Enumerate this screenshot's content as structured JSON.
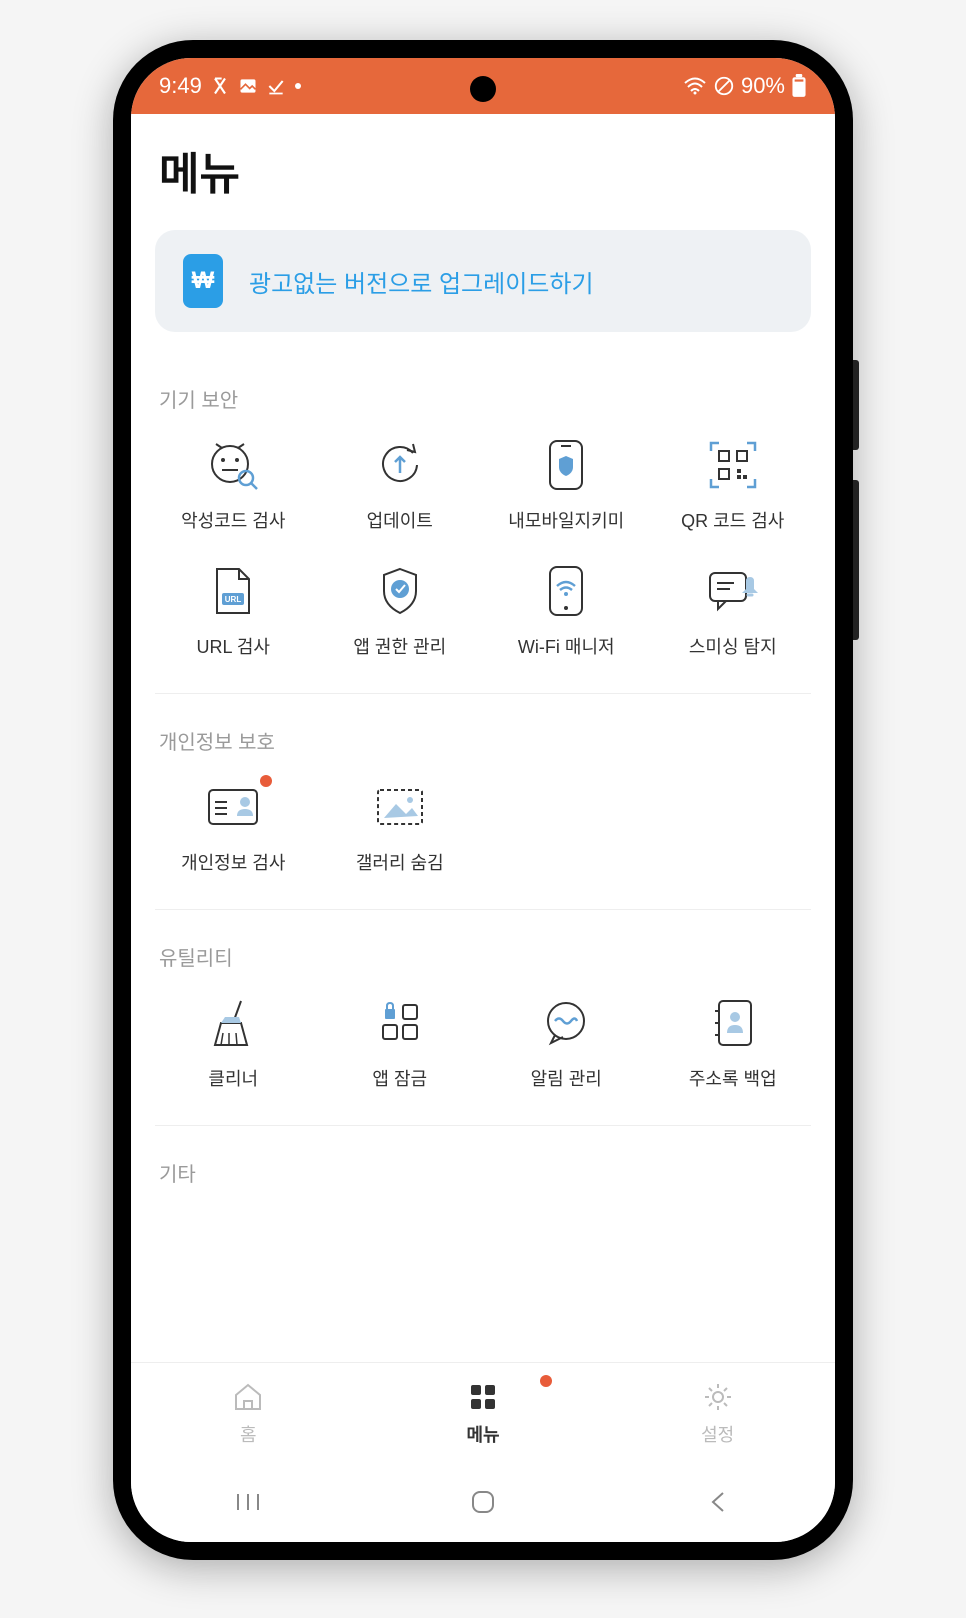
{
  "status": {
    "time": "9:49",
    "battery_label": "90%"
  },
  "title": "메뉴",
  "upgrade": {
    "icon_text": "₩",
    "text": "광고없는 버전으로 업그레이드하기"
  },
  "sections": {
    "device_security": {
      "title": "기기 보안",
      "items": {
        "malware": "악성코드 검사",
        "update": "업데이트",
        "mobile_guard": "내모바일지키미",
        "qr": "QR 코드 검사",
        "url": "URL 검사",
        "app_perm": "앱 권한 관리",
        "wifi": "Wi-Fi 매니저",
        "smishing": "스미싱 탐지"
      }
    },
    "privacy": {
      "title": "개인정보 보호",
      "items": {
        "privacy_scan": "개인정보 검사",
        "gallery_hide": "갤러리 숨김"
      }
    },
    "utility": {
      "title": "유틸리티",
      "items": {
        "cleaner": "클리너",
        "app_lock": "앱 잠금",
        "notif": "알림 관리",
        "contacts": "주소록 백업"
      }
    },
    "etc": {
      "title": "기타"
    }
  },
  "nav": {
    "home": "홈",
    "menu": "메뉴",
    "settings": "설정"
  }
}
